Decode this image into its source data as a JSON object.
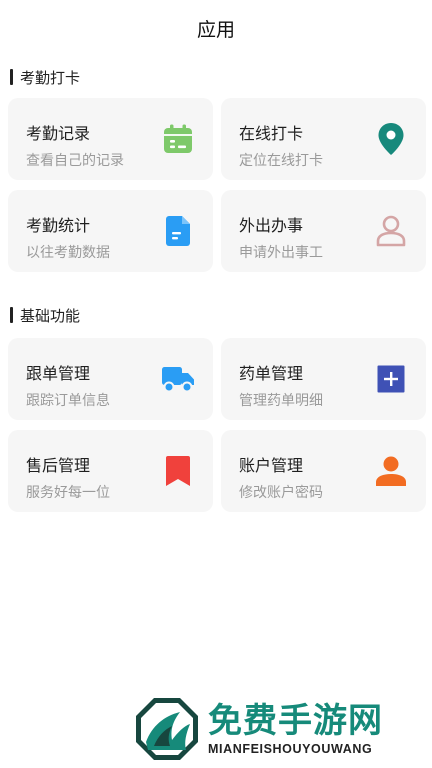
{
  "header": {
    "title": "应用"
  },
  "sections": [
    {
      "title": "考勤打卡",
      "cards": [
        {
          "title": "考勤记录",
          "subtitle": "查看自己的记录",
          "icon": "calendar-icon",
          "color": "#7ec96a"
        },
        {
          "title": "在线打卡",
          "subtitle": "定位在线打卡",
          "icon": "location-pin-icon",
          "color": "#17897c"
        },
        {
          "title": "考勤统计",
          "subtitle": "以往考勤数据",
          "icon": "document-icon",
          "color": "#2a9df4"
        },
        {
          "title": "外出办事",
          "subtitle": "申请外出事工",
          "icon": "person-icon",
          "color": "#d4a5a5"
        }
      ]
    },
    {
      "title": "基础功能",
      "cards": [
        {
          "title": "跟单管理",
          "subtitle": "跟踪订单信息",
          "icon": "truck-icon",
          "color": "#2a9df4"
        },
        {
          "title": "药单管理",
          "subtitle": "管理药单明细",
          "icon": "plus-box-icon",
          "color": "#3f51b5"
        },
        {
          "title": "售后管理",
          "subtitle": "服务好每一位",
          "icon": "bookmark-icon",
          "color": "#f0413c"
        },
        {
          "title": "账户管理",
          "subtitle": "修改账户密码",
          "icon": "user-solid-icon",
          "color": "#f26c22"
        }
      ]
    }
  ],
  "watermark": {
    "name_cn": "免费手游网",
    "name_en": "MIANFEISHOUYOUWANG"
  }
}
